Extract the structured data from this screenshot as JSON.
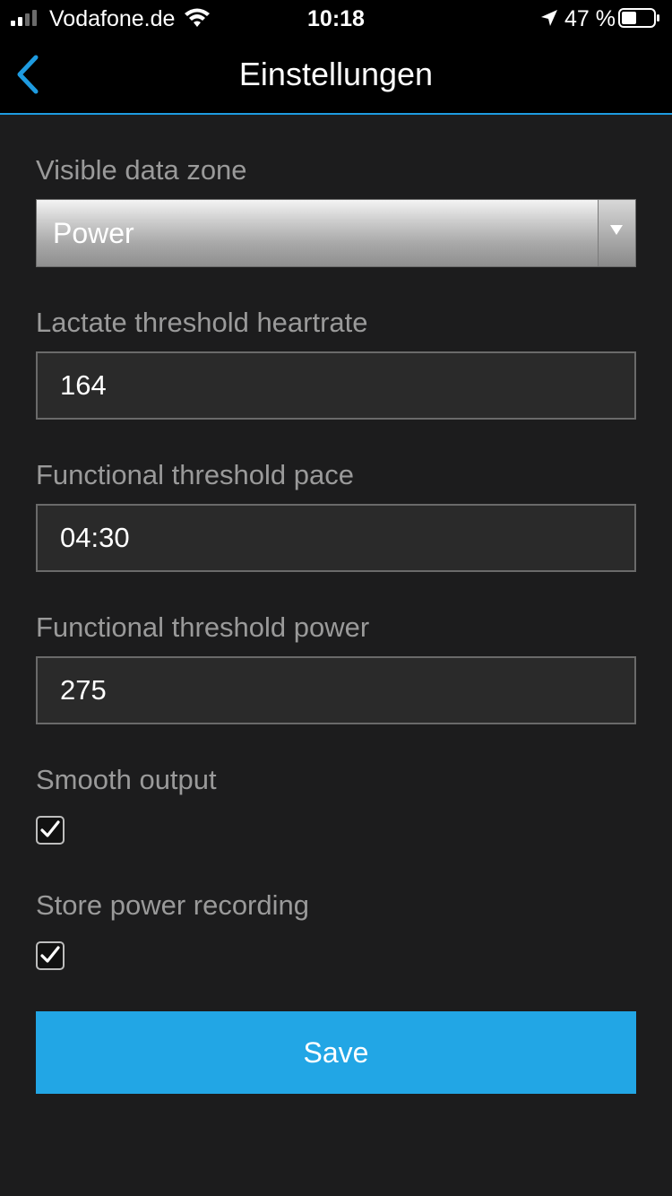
{
  "status_bar": {
    "carrier": "Vodafone.de",
    "time": "10:18",
    "battery_percent": "47 %",
    "battery_level": 0.47
  },
  "nav": {
    "title": "Einstellungen",
    "back_icon": "chevron-left-icon"
  },
  "form": {
    "visible_data_zone": {
      "label": "Visible data zone",
      "selected": "Power"
    },
    "lactate_threshold_heartrate": {
      "label": "Lactate threshold heartrate",
      "value": "164"
    },
    "functional_threshold_pace": {
      "label": "Functional threshold pace",
      "value": "04:30"
    },
    "functional_threshold_power": {
      "label": "Functional threshold power",
      "value": "275"
    },
    "smooth_output": {
      "label": "Smooth output",
      "checked": true
    },
    "store_power_recording": {
      "label": "Store power recording",
      "checked": true
    },
    "save_label": "Save"
  },
  "colors": {
    "accent": "#22a6e5",
    "background": "#1c1c1d",
    "label": "#9a9a9a"
  }
}
